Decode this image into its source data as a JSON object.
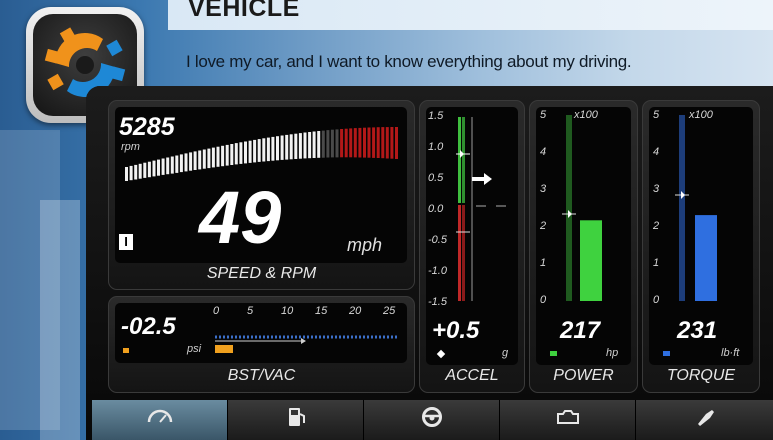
{
  "header": {
    "title": "VEHICLE",
    "tagline": "I love my car, and I want to know everything about my driving."
  },
  "app_icon": {
    "name": "gear-icon",
    "colors": [
      "#f0921b",
      "#1e88d6"
    ]
  },
  "speed_rpm": {
    "rpm_value": "5285",
    "rpm_unit": "rpm",
    "gear": "I",
    "speed_value": "49",
    "speed_unit": "mph",
    "label": "SPEED & RPM",
    "rpm_fill_fraction": 0.72
  },
  "bstvac": {
    "value": "-02.5",
    "unit": "psi",
    "scale": [
      "0",
      "5",
      "10",
      "15",
      "20",
      "25"
    ],
    "label": "BST/VAC"
  },
  "accel": {
    "scale": [
      "1.5",
      "1.0",
      "0.5",
      "0.0",
      "-0.5",
      "-1.0",
      "-1.5"
    ],
    "value": "+0.5",
    "unit": "g",
    "label": "ACCEL"
  },
  "power": {
    "multiplier": "x100",
    "scale": [
      "5",
      "4",
      "3",
      "2",
      "1",
      "0"
    ],
    "value": "217",
    "unit": "hp",
    "label": "POWER",
    "level": 2.17,
    "color": "#3fd23f"
  },
  "torque": {
    "multiplier": "x100",
    "scale": [
      "5",
      "4",
      "3",
      "2",
      "1",
      "0"
    ],
    "value": "231",
    "unit": "lb·ft",
    "label": "TORQUE",
    "level": 2.31,
    "color": "#2f6fe0"
  },
  "tabs": [
    {
      "icon": "gauge-icon",
      "active": true
    },
    {
      "icon": "fuel-icon",
      "active": false
    },
    {
      "icon": "steering-wheel-icon",
      "active": false
    },
    {
      "icon": "engine-icon",
      "active": false
    },
    {
      "icon": "wrench-icon",
      "active": false
    }
  ]
}
